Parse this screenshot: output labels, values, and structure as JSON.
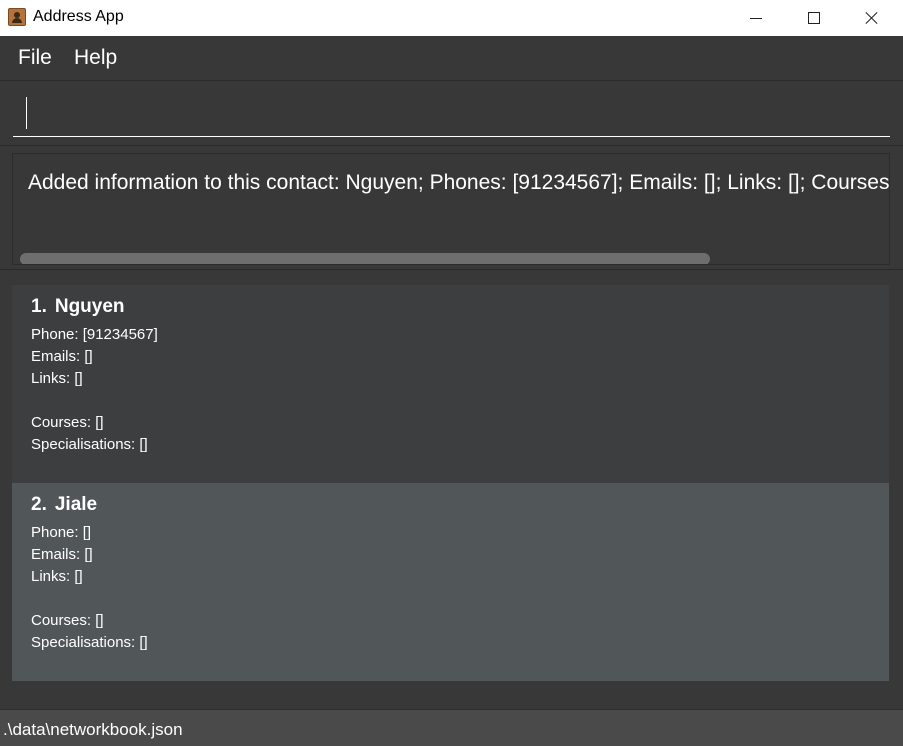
{
  "window": {
    "title": "Address App",
    "icon": "address-book-icon"
  },
  "menu": {
    "file": "File",
    "help": "Help"
  },
  "command": {
    "value": "",
    "placeholder": ""
  },
  "result": {
    "text": "Added information to this contact: Nguyen; Phones: [91234567]; Emails: []; Links: []; Courses: []; S"
  },
  "contacts": [
    {
      "index": "1.",
      "name": "Nguyen",
      "phone": "Phone: [91234567]",
      "emails": "Emails: []",
      "links": "Links: []",
      "blank": "",
      "courses": "Courses: []",
      "specialisations": "Specialisations: []"
    },
    {
      "index": "2.",
      "name": "Jiale",
      "phone": "Phone: []",
      "emails": "Emails: []",
      "links": "Links: []",
      "blank": "",
      "courses": "Courses: []",
      "specialisations": "Specialisations: []"
    }
  ],
  "status": {
    "path": ".\\data\\networkbook.json"
  },
  "colors": {
    "background": "#383838",
    "card_default": "#3c3e3f",
    "card_selected": "#515658",
    "statusbar": "#4a4a4a"
  }
}
